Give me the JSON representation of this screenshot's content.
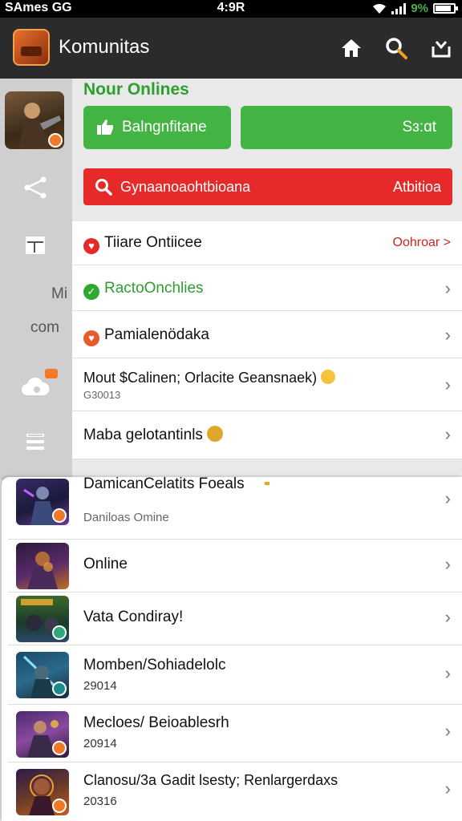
{
  "status_bar": {
    "carrier": "SAmes GG",
    "time": "4:9R",
    "battery_pct": "9%",
    "battery_level": 0.85
  },
  "app_bar": {
    "title": "Komunitas",
    "icons": [
      "home-icon",
      "search-icon",
      "inbox-icon"
    ]
  },
  "rail": {
    "bg_text_1": "Mi",
    "bg_text_2": "com",
    "icons": [
      "share-icon",
      "layout-icon",
      "cloud-icon",
      "list-icon"
    ]
  },
  "main": {
    "header": "Nour Onlines",
    "green_button_1": "Balngnfitane",
    "green_button_2": "Sɜ:ɑt",
    "red_search": {
      "label": "Gynaanoaohtbioana",
      "action": "Atbitioa"
    },
    "list": [
      {
        "title": "Tiiare Ontiicee",
        "trailing": "Oohroar >",
        "dot": "red"
      },
      {
        "title": "RactoOnchlies",
        "dot": "green"
      },
      {
        "title": "Pamialenödaka",
        "dot": "orange"
      },
      {
        "title": "Mout $Calinen; Orlacite Geansnaek)",
        "sub": "G30013",
        "emoji": true
      },
      {
        "title": "Maba gelotantinls",
        "emoji": true
      }
    ]
  },
  "overlay": {
    "first": {
      "title": "DamicanCelatits Foeals",
      "sub": "Daniloas Omine"
    },
    "items": [
      {
        "title": "Online",
        "sub": ""
      },
      {
        "title": "Vata Condiray!",
        "sub": ""
      },
      {
        "title": "Momben/Sohiadelolc",
        "sub": "29014"
      },
      {
        "title": "Mecloes/ Beioablesrh",
        "sub": "20914"
      },
      {
        "title": "Clanosu/3a Gadit lsesty; Renlargerdaxs",
        "sub": "20316"
      }
    ]
  },
  "colors": {
    "green": "#43b343",
    "red": "#e62a2a",
    "header_green": "#2e9e2e",
    "appbar": "#2b2b2b"
  }
}
